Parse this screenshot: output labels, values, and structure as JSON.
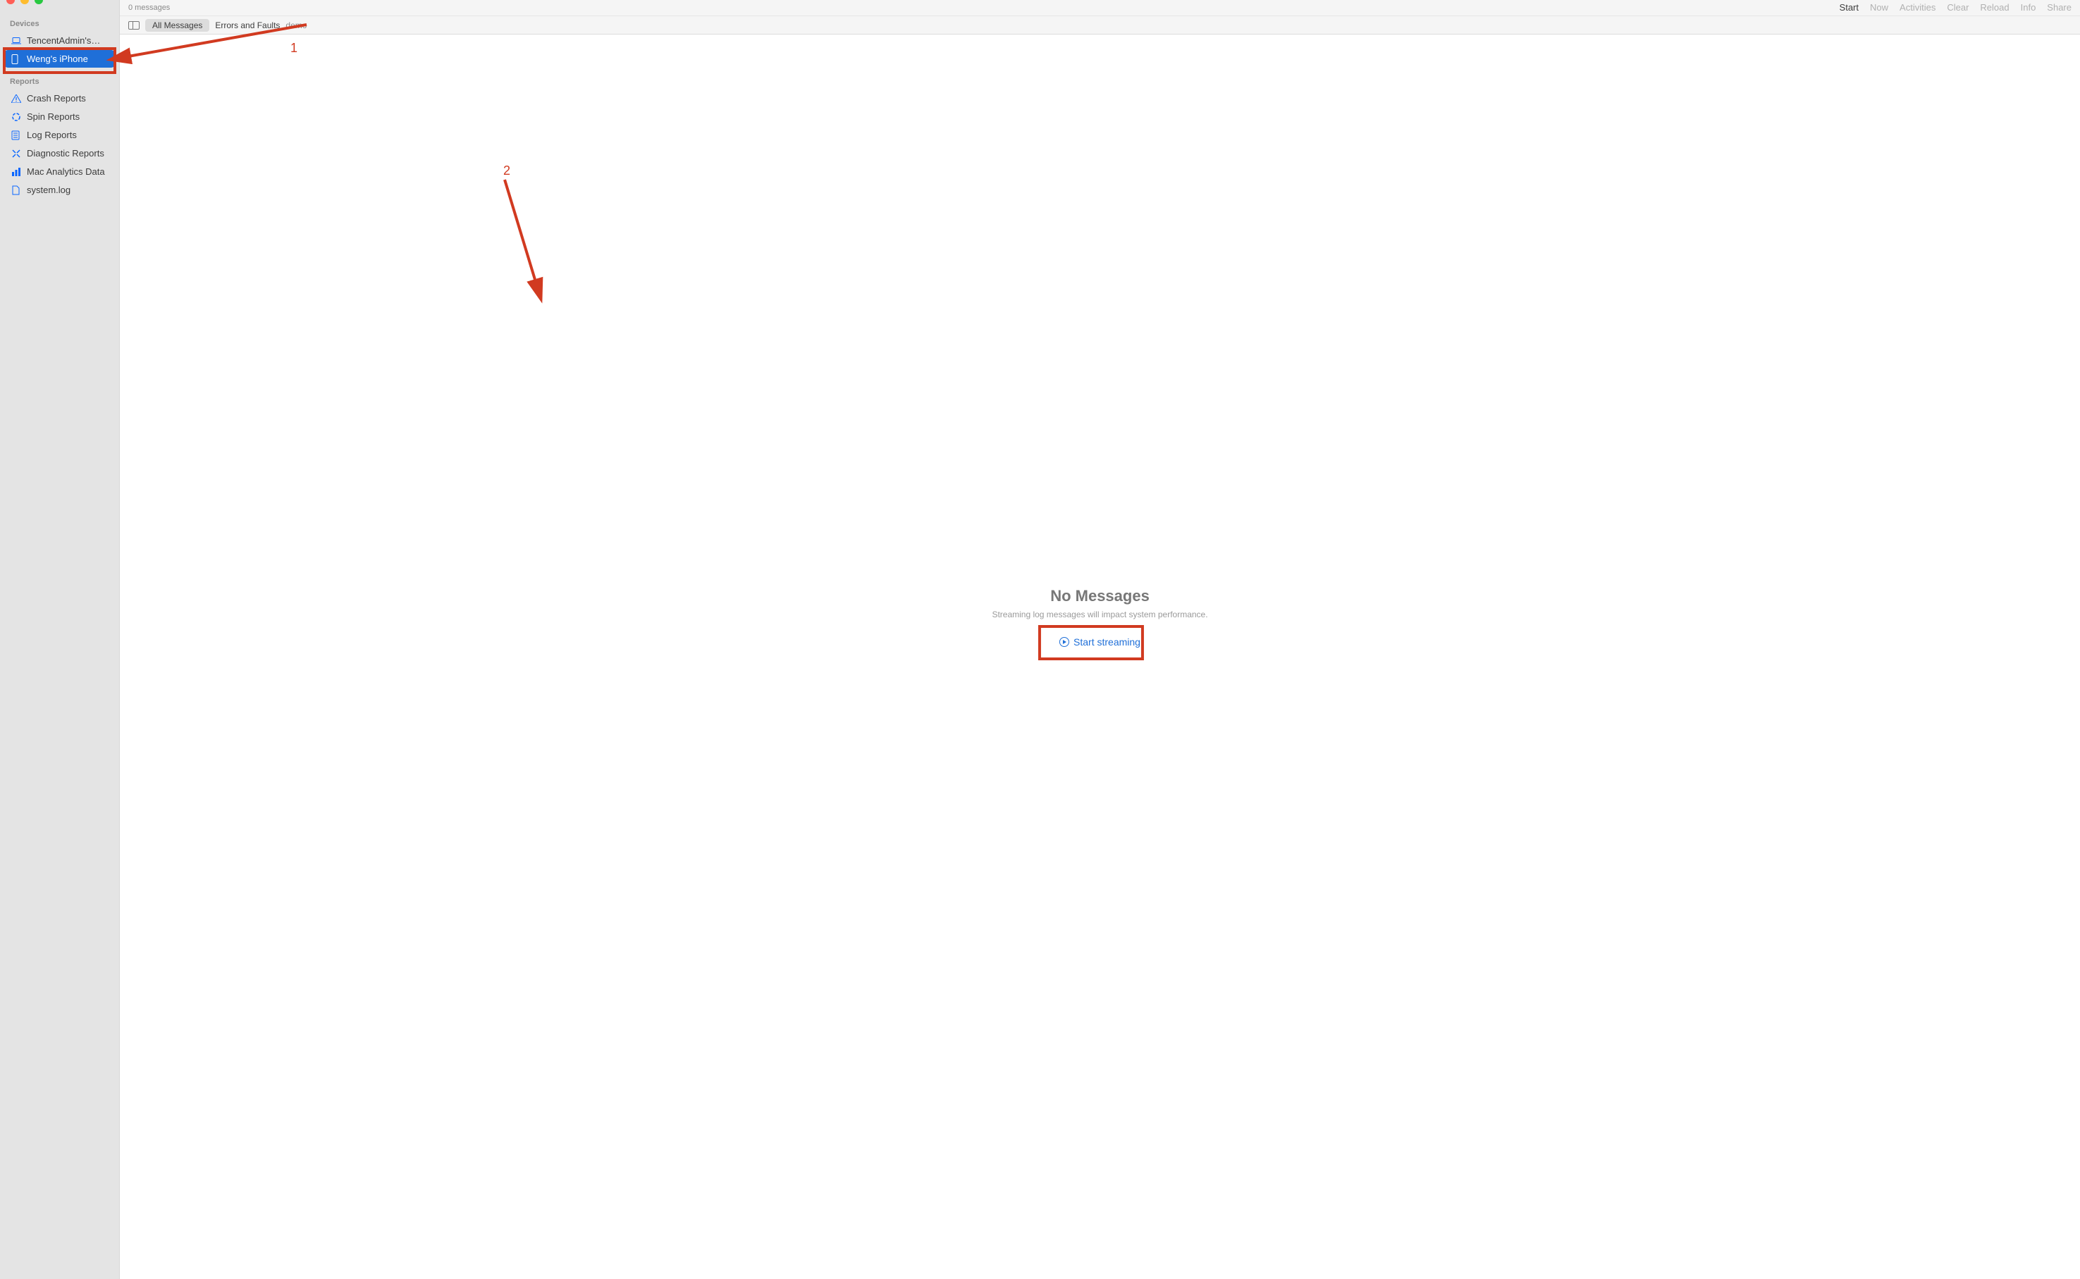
{
  "titlebar": {
    "message_count": "0 messages"
  },
  "toolbar": {
    "start": "Start",
    "now": "Now",
    "activities": "Activities",
    "clear": "Clear",
    "reload": "Reload",
    "info": "Info",
    "share": "Share"
  },
  "filter": {
    "all_messages": "All Messages",
    "errors_and_faults": "Errors and Faults",
    "search_text": "demo"
  },
  "sidebar": {
    "section_devices": "Devices",
    "devices": [
      {
        "label": "TencentAdmin's…"
      },
      {
        "label": "Weng's iPhone"
      }
    ],
    "section_reports": "Reports",
    "reports": [
      {
        "label": "Crash Reports"
      },
      {
        "label": "Spin Reports"
      },
      {
        "label": "Log Reports"
      },
      {
        "label": "Diagnostic Reports"
      },
      {
        "label": "Mac Analytics Data"
      },
      {
        "label": "system.log"
      }
    ]
  },
  "empty": {
    "title": "No Messages",
    "subtitle": "Streaming log messages will impact system performance.",
    "action": "Start streaming"
  },
  "annotations": {
    "label1": "1",
    "label2": "2"
  }
}
